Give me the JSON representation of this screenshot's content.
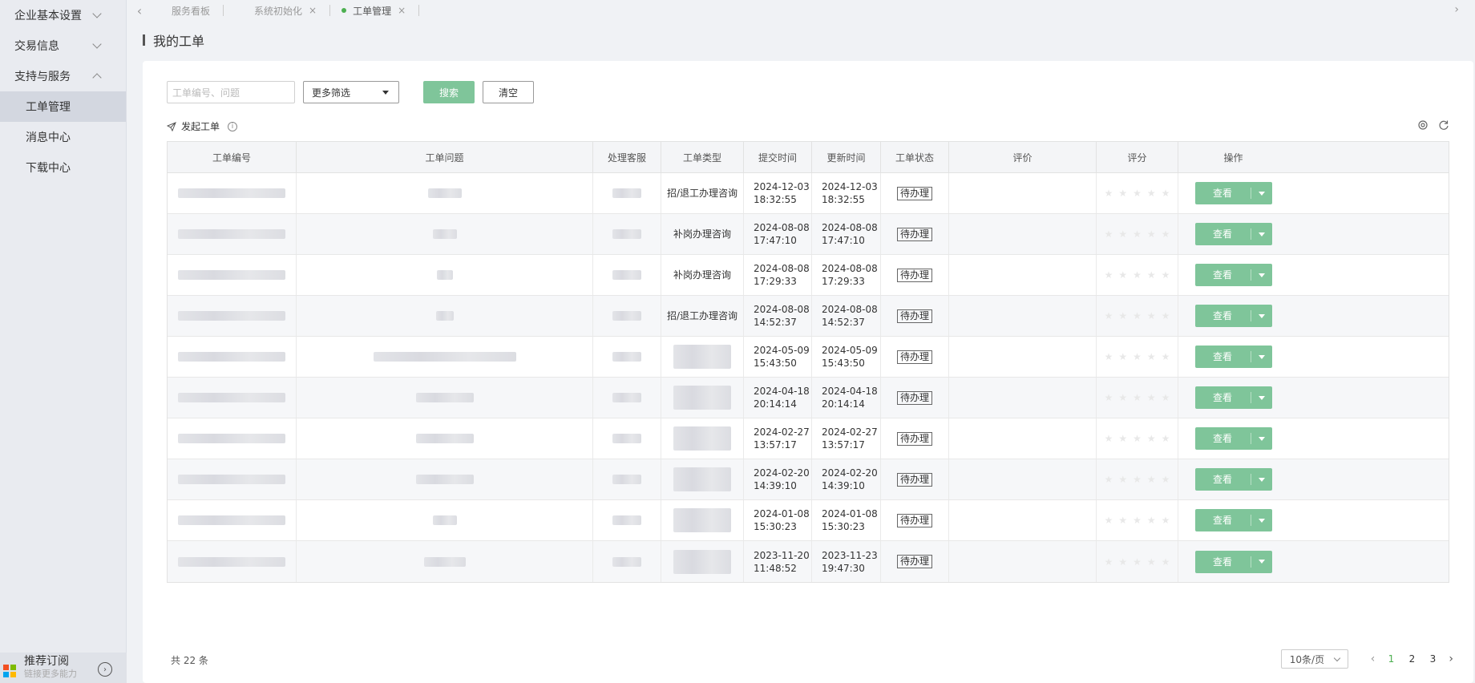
{
  "sidebar": {
    "groups": [
      {
        "label": "企业基本设置",
        "expanded": false
      },
      {
        "label": "交易信息",
        "expanded": false
      },
      {
        "label": "支持与服务",
        "expanded": true
      }
    ],
    "sub_items": [
      {
        "label": "工单管理",
        "active": true
      },
      {
        "label": "消息中心",
        "active": false
      },
      {
        "label": "下载中心",
        "active": false
      }
    ],
    "bottom": {
      "title": "推荐订阅",
      "desc": "链接更多能力"
    }
  },
  "tabs": [
    {
      "label": "服务看板",
      "closable": false
    },
    {
      "label": "系统初始化",
      "closable": true
    },
    {
      "label": "工单管理",
      "closable": true,
      "active": true
    }
  ],
  "page_title": "我的工单",
  "filters": {
    "search_placeholder": "工单编号、问题",
    "more_filter": "更多筛选",
    "search_btn": "搜索",
    "clear_btn": "清空"
  },
  "actions": {
    "create": "发起工单"
  },
  "colors": {
    "accent": "#7fc59a",
    "active_dot": "#4caf50"
  },
  "table": {
    "columns": [
      {
        "label": "工单编号"
      },
      {
        "label": "工单问题"
      },
      {
        "label": "处理客服"
      },
      {
        "label": "工单类型"
      },
      {
        "label": "提交时间"
      },
      {
        "label": "更新时间"
      },
      {
        "label": "工单状态"
      },
      {
        "label": "评价"
      },
      {
        "label": "评分"
      },
      {
        "label": "操作"
      }
    ],
    "rows": [
      {
        "type": "招/退工办理咨询",
        "submit_date": "2024-12-03",
        "submit_time": "18:32:55",
        "update_date": "2024-12-03",
        "update_time": "18:32:55",
        "status": "待办理",
        "action": "查看"
      },
      {
        "type": "补岗办理咨询",
        "submit_date": "2024-08-08",
        "submit_time": "17:47:10",
        "update_date": "2024-08-08",
        "update_time": "17:47:10",
        "status": "待办理",
        "action": "查看"
      },
      {
        "type": "补岗办理咨询",
        "submit_date": "2024-08-08",
        "submit_time": "17:29:33",
        "update_date": "2024-08-08",
        "update_time": "17:29:33",
        "status": "待办理",
        "action": "查看"
      },
      {
        "type": "招/退工办理咨询",
        "submit_date": "2024-08-08",
        "submit_time": "14:52:37",
        "update_date": "2024-08-08",
        "update_time": "14:52:37",
        "status": "待办理",
        "action": "查看"
      },
      {
        "type": "",
        "submit_date": "2024-05-09",
        "submit_time": "15:43:50",
        "update_date": "2024-05-09",
        "update_time": "15:43:50",
        "status": "待办理",
        "action": "查看"
      },
      {
        "type": "",
        "submit_date": "2024-04-18",
        "submit_time": "20:14:14",
        "update_date": "2024-04-18",
        "update_time": "20:14:14",
        "status": "待办理",
        "action": "查看"
      },
      {
        "type": "",
        "submit_date": "2024-02-27",
        "submit_time": "13:57:17",
        "update_date": "2024-02-27",
        "update_time": "13:57:17",
        "status": "待办理",
        "action": "查看"
      },
      {
        "type": "",
        "submit_date": "2024-02-20",
        "submit_time": "14:39:10",
        "update_date": "2024-02-20",
        "update_time": "14:39:10",
        "status": "待办理",
        "action": "查看"
      },
      {
        "type": "",
        "submit_date": "2024-01-08",
        "submit_time": "15:30:23",
        "update_date": "2024-01-08",
        "update_time": "15:30:23",
        "status": "待办理",
        "action": "查看"
      },
      {
        "type": "",
        "submit_date": "2023-11-20",
        "submit_time": "11:48:52",
        "update_date": "2023-11-23",
        "update_time": "19:47:30",
        "status": "待办理",
        "action": "查看"
      }
    ]
  },
  "pagination": {
    "total": "共 22 条",
    "page_size": "10条/页",
    "pages": [
      "1",
      "2",
      "3"
    ],
    "current": "1"
  }
}
